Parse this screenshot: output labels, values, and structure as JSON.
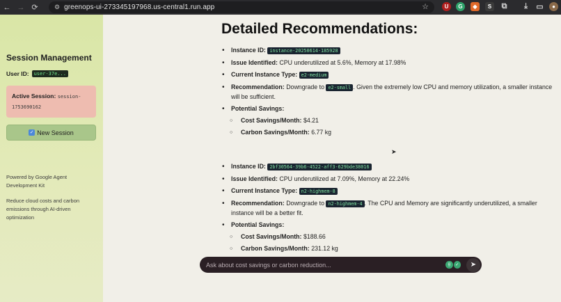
{
  "browser": {
    "url": "greenops-ui-273345197968.us-central1.run.app"
  },
  "sidebar": {
    "title": "Session Management",
    "user_label": "User ID:",
    "user_id": "user-37e...",
    "active_session_label": "Active Session:",
    "session_id": "session-1753690162",
    "new_session_label": "New Session",
    "powered_by": "Powered by Google Agent Development Kit",
    "tagline": "Reduce cloud costs and carbon emissions through AI-driven optimization"
  },
  "main": {
    "heading": "Detailed Recommendations:",
    "labels": {
      "instance_id": "Instance ID:",
      "issue": "Issue Identified:",
      "current_type": "Current Instance Type:",
      "recommendation": "Recommendation:",
      "potential_savings": "Potential Savings:",
      "cost_savings": "Cost Savings/Month:",
      "carbon_savings": "Carbon Savings/Month:",
      "downgrade_to": "Downgrade to"
    },
    "recommendations": [
      {
        "instance_id": "instance-20250614-185928",
        "issue": "CPU underutilized at 5.6%, Memory at 17.98%",
        "current_type": "e2-medium",
        "target_type": "e2-small",
        "recommendation_text": ". Given the extremely low CPU and memory utilization, a smaller instance will be sufficient.",
        "cost_savings": "$4.21",
        "carbon_savings": "6.77 kg"
      },
      {
        "instance_id": "2bf30564-39b6-4522-aff3-629bde38016",
        "issue": "CPU underutilized at 7.09%, Memory at 22.24%",
        "current_type": "n2-highmem-8",
        "target_type": "n2-highmem-4",
        "recommendation_text": ". The CPU and Memory are significantly underutilized, a smaller instance will be a better fit.",
        "cost_savings": "$188.66",
        "carbon_savings": "231.12 kg"
      }
    ]
  },
  "chat": {
    "placeholder": "Ask about cost savings or carbon reduction..."
  },
  "colors": {
    "sidebar_bg": "#d9e6a6",
    "session_box": "#eebcb0",
    "new_session_btn": "#a9c68a",
    "chat_bg": "#2a1f24",
    "code_text": "#6fe38a"
  }
}
